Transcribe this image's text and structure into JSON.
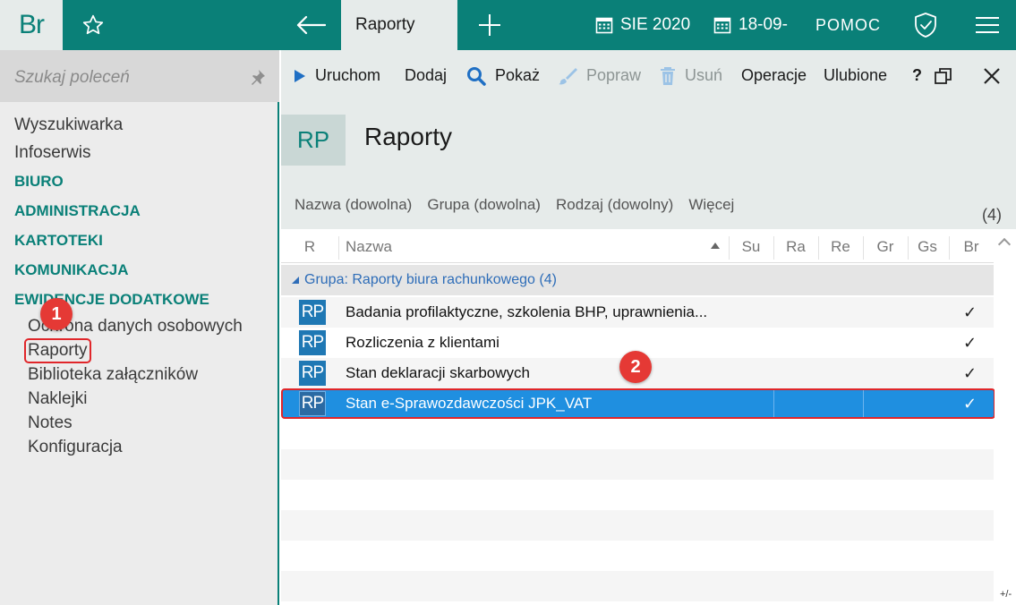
{
  "topbar": {
    "logo": "Br",
    "active_tab": "Raporty",
    "period": "SIE 2020",
    "date": "18-09-",
    "help": "POMOC"
  },
  "sidebar": {
    "search_placeholder": "Szukaj poleceń",
    "items": [
      {
        "label": "Wyszukiwarka",
        "kind": "item"
      },
      {
        "label": "Infoserwis",
        "kind": "item"
      },
      {
        "label": "BIURO",
        "kind": "section"
      },
      {
        "label": "ADMINISTRACJA",
        "kind": "section"
      },
      {
        "label": "KARTOTEKI",
        "kind": "section"
      },
      {
        "label": "KOMUNIKACJA",
        "kind": "section"
      },
      {
        "label": "EWIDENCJE DODATKOWE",
        "kind": "section"
      }
    ],
    "subitems": [
      "Ochrona danych osobowych",
      "Raporty",
      "Biblioteka załączników",
      "Naklejki",
      "Notes",
      "Konfiguracja"
    ]
  },
  "toolbar": {
    "run": "Uruchom",
    "add": "Dodaj",
    "show": "Pokaż",
    "edit": "Popraw",
    "delete": "Usuń",
    "operations": "Operacje",
    "favorites": "Ulubione",
    "help": "?"
  },
  "header": {
    "badge": "RP",
    "title": "Raporty"
  },
  "filters": {
    "name": "Nazwa (dowolna)",
    "group": "Grupa (dowolna)",
    "kind": "Rodzaj (dowolny)",
    "more": "Więcej",
    "count": "(4)"
  },
  "table": {
    "columns": [
      "R",
      "Nazwa",
      "Su",
      "Ra",
      "Re",
      "Gr",
      "Gs",
      "Br"
    ],
    "group_label": "Grupa",
    "group_name": ": Raporty biura rachunkowego (4)",
    "rows": [
      {
        "icon": "RP",
        "name": "Badania profilaktyczne, szkolenia BHP, uprawnienia...",
        "br": "✓"
      },
      {
        "icon": "RP",
        "name": "Rozliczenia z klientami",
        "br": "✓"
      },
      {
        "icon": "RP",
        "name": "Stan deklaracji skarbowych",
        "br": "✓"
      },
      {
        "icon": "RP",
        "name": "Stan e-Sprawozdawczości JPK_VAT",
        "br": "✓"
      }
    ],
    "footer": "+/-"
  },
  "callouts": {
    "one": "1",
    "two": "2"
  },
  "colors": {
    "brand": "#0a8078",
    "selection": "#1f8fe0",
    "highlight": "#e0262a"
  }
}
